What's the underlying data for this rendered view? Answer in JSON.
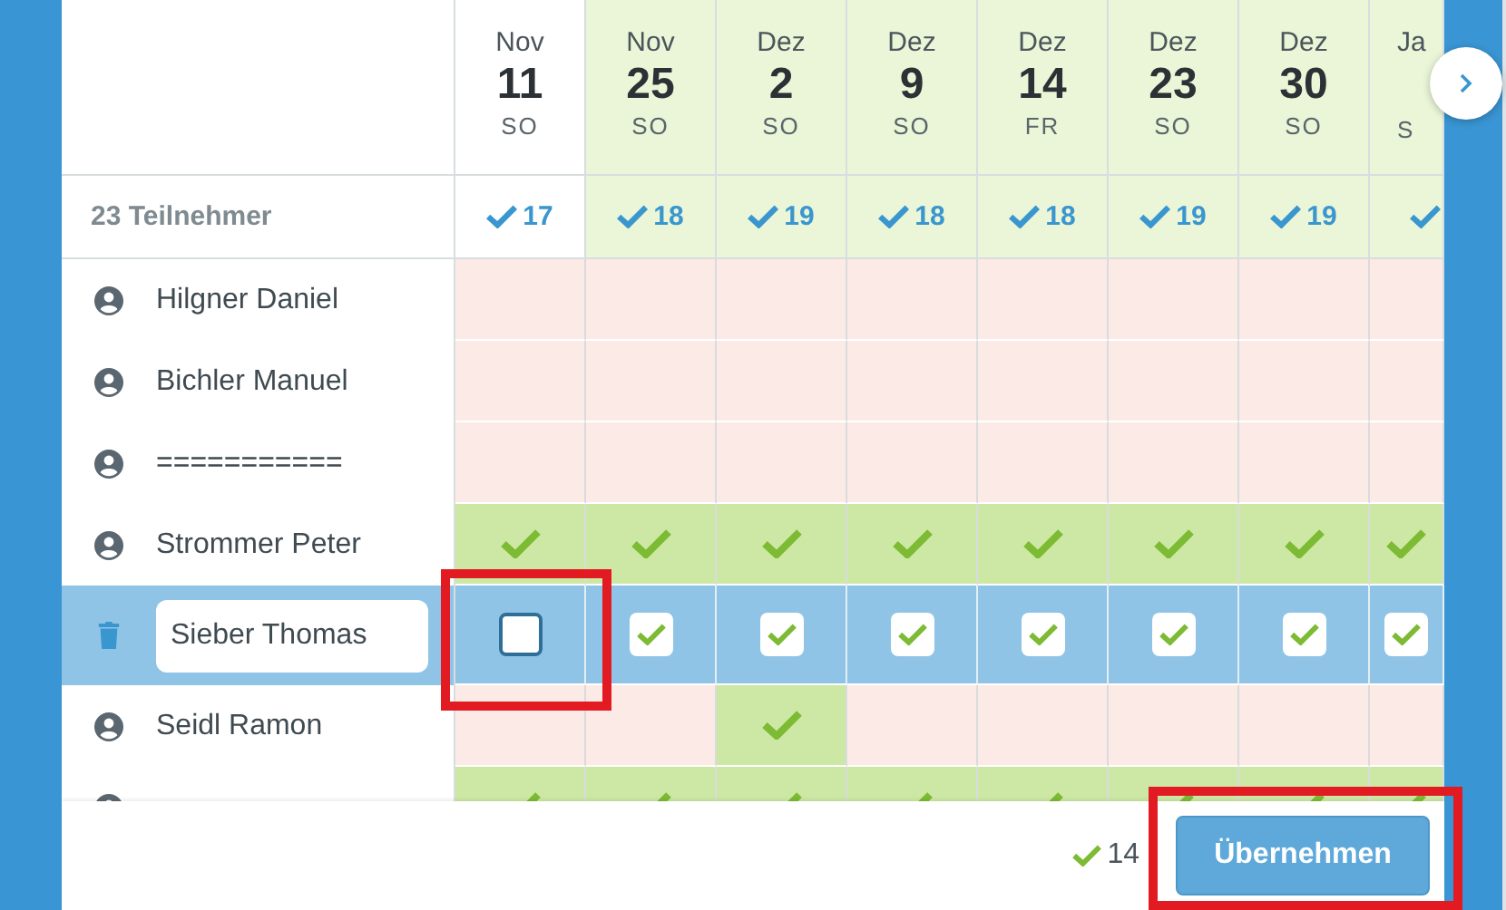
{
  "columns": [
    {
      "month": "Nov",
      "day": "11",
      "weekday": "SO",
      "count": "17",
      "highlighted": false
    },
    {
      "month": "Nov",
      "day": "25",
      "weekday": "SO",
      "count": "18",
      "highlighted": true
    },
    {
      "month": "Dez",
      "day": "2",
      "weekday": "SO",
      "count": "19",
      "highlighted": true
    },
    {
      "month": "Dez",
      "day": "9",
      "weekday": "SO",
      "count": "18",
      "highlighted": true
    },
    {
      "month": "Dez",
      "day": "14",
      "weekday": "FR",
      "count": "18",
      "highlighted": true
    },
    {
      "month": "Dez",
      "day": "23",
      "weekday": "SO",
      "count": "19",
      "highlighted": true
    },
    {
      "month": "Dez",
      "day": "30",
      "weekday": "SO",
      "count": "19",
      "highlighted": true
    },
    {
      "month": "Ja",
      "weekday": "S",
      "highlighted": true
    }
  ],
  "summary_label": "23 Teilnehmer",
  "participants": [
    {
      "kind": "person",
      "name": "Hilgner Daniel",
      "votes": [
        false,
        false,
        false,
        false,
        false,
        false,
        false,
        false
      ]
    },
    {
      "kind": "person",
      "name": "Bichler Manuel",
      "votes": [
        false,
        false,
        false,
        false,
        false,
        false,
        false,
        false
      ]
    },
    {
      "kind": "person",
      "name": "===========",
      "votes": [
        false,
        false,
        false,
        false,
        false,
        false,
        false,
        false
      ]
    },
    {
      "kind": "person",
      "name": "Strommer Peter",
      "votes": [
        true,
        true,
        true,
        true,
        true,
        true,
        true,
        true
      ]
    },
    {
      "kind": "editing",
      "name": "Sieber Thomas",
      "votes": [
        false,
        true,
        true,
        true,
        true,
        true,
        true,
        true
      ]
    },
    {
      "kind": "person",
      "name": "Seidl Ramon",
      "votes": [
        false,
        false,
        true,
        false,
        false,
        false,
        false,
        false
      ]
    },
    {
      "kind": "person",
      "votes": [
        true,
        true,
        true,
        true,
        true,
        true,
        true,
        true
      ]
    }
  ],
  "footer": {
    "count": "14",
    "button": "Übernehmen"
  }
}
